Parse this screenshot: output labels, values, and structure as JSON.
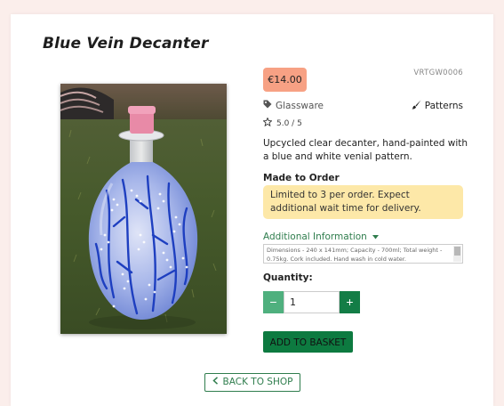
{
  "product": {
    "title": "Blue Vein Decanter",
    "price": "€14.00",
    "sku": "VRTGW0006",
    "category": "Glassware",
    "style": "Patterns",
    "rating": "5.0 / 5",
    "description": "Upcycled clear decanter, hand-painted with a blue and white venial pattern.",
    "made_to_order_title": "Made to Order",
    "made_to_order_note": "Limited to 3 per order. Expect additional wait time for delivery.",
    "additional_info_label": "Additional Information",
    "additional_info_text": "Dimensions - 240 x 141mm; Capacity - 700ml; Total weight - 0.75kg. Cork included. Hand wash in cold water."
  },
  "purchase": {
    "quantity_label": "Quantity:",
    "quantity_value": "1",
    "decrement_symbol": "−",
    "increment_symbol": "+",
    "add_to_basket": "ADD TO BASKET"
  },
  "nav": {
    "back_to_shop": "BACK TO SHOP",
    "back_icon": "chevron-left-icon"
  },
  "colors": {
    "page_bg": "#fbeeeb",
    "price_badge": "#f7a184",
    "notice_bg": "#fde8a8",
    "accent_green": "#2f7d4d",
    "button_green": "#0d7a40",
    "minus_green": "#4fb07e",
    "plus_green": "#137d46"
  },
  "icons": {
    "category_icon": "tag-icon",
    "style_icon": "paintbrush-icon",
    "rating_icon": "star-outline-icon",
    "dropdown_icon": "caret-down-icon"
  }
}
